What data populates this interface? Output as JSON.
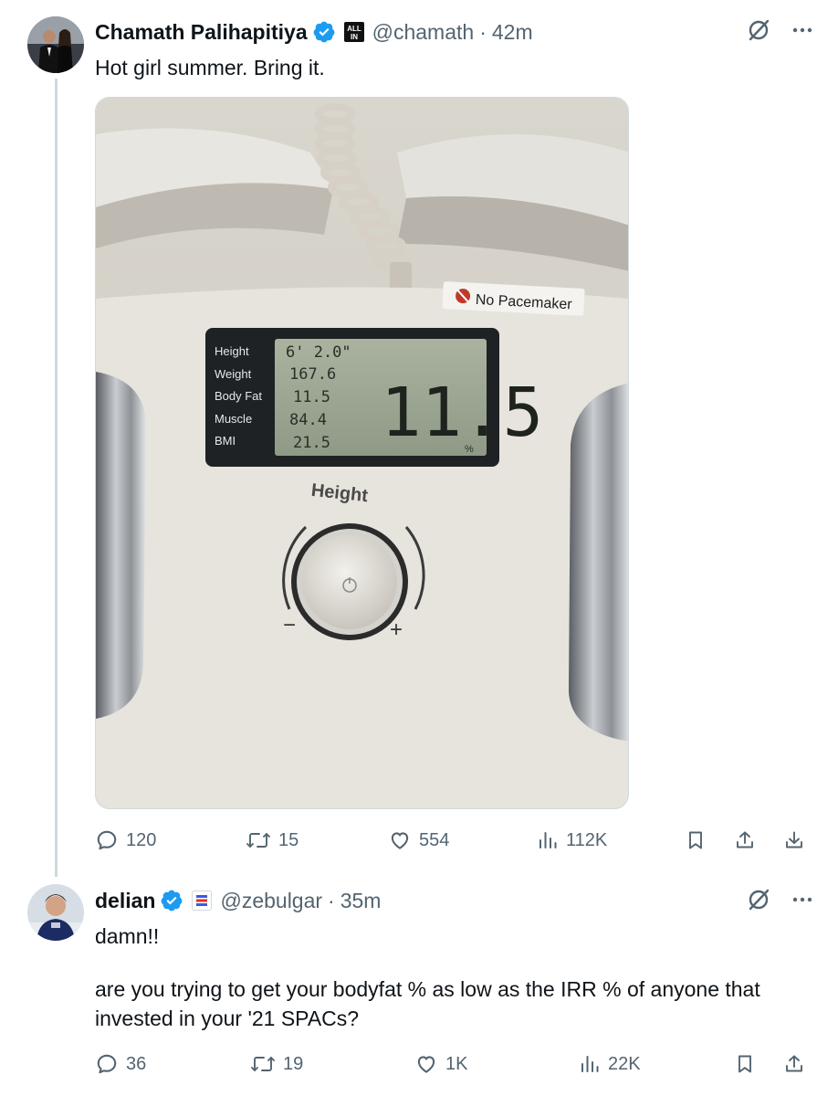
{
  "colors": {
    "text": "#0f1419",
    "secondary": "#536471",
    "verified": "#1d9bf0",
    "thread_line": "#cfd9de"
  },
  "tweets": [
    {
      "author_name": "Chamath Palihapitiya",
      "affiliate_badge": "ALL IN",
      "handle": "@chamath",
      "time": "42m",
      "text": "Hot girl summer. Bring it.",
      "media": {
        "sign": "No Pacemaker",
        "display_labels": [
          "Height",
          "Weight",
          "Body Fat",
          "Muscle",
          "BMI"
        ],
        "display_values": [
          "6' 2.0\"",
          "167.6",
          "11.5",
          "84.4",
          "21.5"
        ],
        "big_value": "11.5",
        "unit": "%",
        "dial_label": "Height",
        "minus": "−",
        "plus": "+"
      },
      "stats": {
        "replies": "120",
        "reposts": "15",
        "likes": "554",
        "views": "112K"
      }
    },
    {
      "author_name": "delian",
      "handle": "@zebulgar",
      "time": "35m",
      "text_line1": "damn!!",
      "text_line2": "are you trying to get your bodyfat % as low as the IRR % of anyone that invested in your '21 SPACs?",
      "stats": {
        "replies": "36",
        "reposts": "19",
        "likes": "1K",
        "views": "22K"
      }
    }
  ],
  "icons": {
    "verified": "verified-badge-icon",
    "grok": "grok-icon",
    "more": "more-icon",
    "reply": "reply-icon",
    "repost": "repost-icon",
    "like": "like-icon",
    "views": "views-icon",
    "bookmark": "bookmark-icon",
    "share": "share-icon",
    "download": "download-icon"
  }
}
